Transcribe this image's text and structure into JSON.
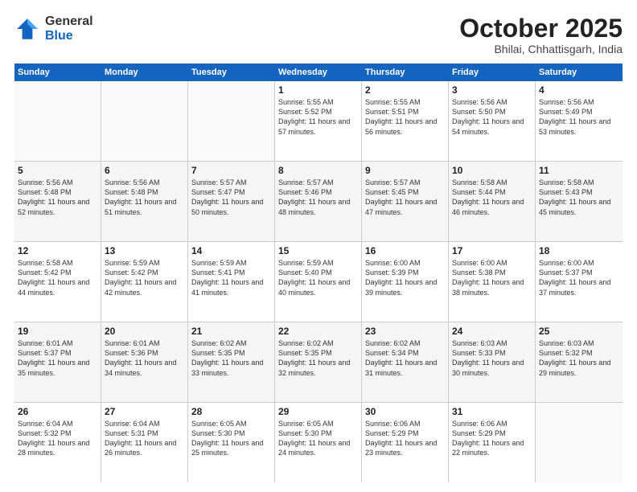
{
  "logo": {
    "general": "General",
    "blue": "Blue"
  },
  "title": "October 2025",
  "subtitle": "Bhilai, Chhattisgarh, India",
  "days_of_week": [
    "Sunday",
    "Monday",
    "Tuesday",
    "Wednesday",
    "Thursday",
    "Friday",
    "Saturday"
  ],
  "weeks": [
    [
      {
        "day": "",
        "empty": true
      },
      {
        "day": "",
        "empty": true
      },
      {
        "day": "",
        "empty": true
      },
      {
        "day": "1",
        "sunrise": "5:55 AM",
        "sunset": "5:52 PM",
        "daylight": "11 hours and 57 minutes."
      },
      {
        "day": "2",
        "sunrise": "5:55 AM",
        "sunset": "5:51 PM",
        "daylight": "11 hours and 56 minutes."
      },
      {
        "day": "3",
        "sunrise": "5:56 AM",
        "sunset": "5:50 PM",
        "daylight": "11 hours and 54 minutes."
      },
      {
        "day": "4",
        "sunrise": "5:56 AM",
        "sunset": "5:49 PM",
        "daylight": "11 hours and 53 minutes."
      }
    ],
    [
      {
        "day": "5",
        "sunrise": "5:56 AM",
        "sunset": "5:48 PM",
        "daylight": "11 hours and 52 minutes."
      },
      {
        "day": "6",
        "sunrise": "5:56 AM",
        "sunset": "5:48 PM",
        "daylight": "11 hours and 51 minutes."
      },
      {
        "day": "7",
        "sunrise": "5:57 AM",
        "sunset": "5:47 PM",
        "daylight": "11 hours and 50 minutes."
      },
      {
        "day": "8",
        "sunrise": "5:57 AM",
        "sunset": "5:46 PM",
        "daylight": "11 hours and 48 minutes."
      },
      {
        "day": "9",
        "sunrise": "5:57 AM",
        "sunset": "5:45 PM",
        "daylight": "11 hours and 47 minutes."
      },
      {
        "day": "10",
        "sunrise": "5:58 AM",
        "sunset": "5:44 PM",
        "daylight": "11 hours and 46 minutes."
      },
      {
        "day": "11",
        "sunrise": "5:58 AM",
        "sunset": "5:43 PM",
        "daylight": "11 hours and 45 minutes."
      }
    ],
    [
      {
        "day": "12",
        "sunrise": "5:58 AM",
        "sunset": "5:42 PM",
        "daylight": "11 hours and 44 minutes."
      },
      {
        "day": "13",
        "sunrise": "5:59 AM",
        "sunset": "5:42 PM",
        "daylight": "11 hours and 42 minutes."
      },
      {
        "day": "14",
        "sunrise": "5:59 AM",
        "sunset": "5:41 PM",
        "daylight": "11 hours and 41 minutes."
      },
      {
        "day": "15",
        "sunrise": "5:59 AM",
        "sunset": "5:40 PM",
        "daylight": "11 hours and 40 minutes."
      },
      {
        "day": "16",
        "sunrise": "6:00 AM",
        "sunset": "5:39 PM",
        "daylight": "11 hours and 39 minutes."
      },
      {
        "day": "17",
        "sunrise": "6:00 AM",
        "sunset": "5:38 PM",
        "daylight": "11 hours and 38 minutes."
      },
      {
        "day": "18",
        "sunrise": "6:00 AM",
        "sunset": "5:37 PM",
        "daylight": "11 hours and 37 minutes."
      }
    ],
    [
      {
        "day": "19",
        "sunrise": "6:01 AM",
        "sunset": "5:37 PM",
        "daylight": "11 hours and 35 minutes."
      },
      {
        "day": "20",
        "sunrise": "6:01 AM",
        "sunset": "5:36 PM",
        "daylight": "11 hours and 34 minutes."
      },
      {
        "day": "21",
        "sunrise": "6:02 AM",
        "sunset": "5:35 PM",
        "daylight": "11 hours and 33 minutes."
      },
      {
        "day": "22",
        "sunrise": "6:02 AM",
        "sunset": "5:35 PM",
        "daylight": "11 hours and 32 minutes."
      },
      {
        "day": "23",
        "sunrise": "6:02 AM",
        "sunset": "5:34 PM",
        "daylight": "11 hours and 31 minutes."
      },
      {
        "day": "24",
        "sunrise": "6:03 AM",
        "sunset": "5:33 PM",
        "daylight": "11 hours and 30 minutes."
      },
      {
        "day": "25",
        "sunrise": "6:03 AM",
        "sunset": "5:32 PM",
        "daylight": "11 hours and 29 minutes."
      }
    ],
    [
      {
        "day": "26",
        "sunrise": "6:04 AM",
        "sunset": "5:32 PM",
        "daylight": "11 hours and 28 minutes."
      },
      {
        "day": "27",
        "sunrise": "6:04 AM",
        "sunset": "5:31 PM",
        "daylight": "11 hours and 26 minutes."
      },
      {
        "day": "28",
        "sunrise": "6:05 AM",
        "sunset": "5:30 PM",
        "daylight": "11 hours and 25 minutes."
      },
      {
        "day": "29",
        "sunrise": "6:05 AM",
        "sunset": "5:30 PM",
        "daylight": "11 hours and 24 minutes."
      },
      {
        "day": "30",
        "sunrise": "6:06 AM",
        "sunset": "5:29 PM",
        "daylight": "11 hours and 23 minutes."
      },
      {
        "day": "31",
        "sunrise": "6:06 AM",
        "sunset": "5:29 PM",
        "daylight": "11 hours and 22 minutes."
      },
      {
        "day": "",
        "empty": true
      }
    ]
  ],
  "labels": {
    "sunrise": "Sunrise:",
    "sunset": "Sunset:",
    "daylight": "Daylight:"
  }
}
